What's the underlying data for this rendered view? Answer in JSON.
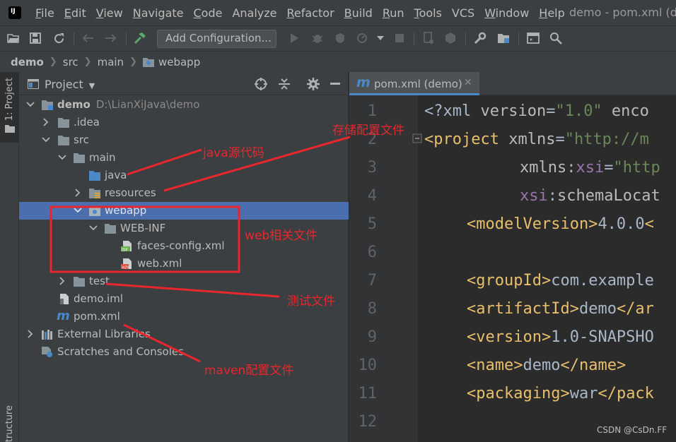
{
  "menubar": {
    "items": [
      {
        "label": "File",
        "ul": "F",
        "rest": "ile"
      },
      {
        "label": "Edit",
        "ul": "E",
        "rest": "dit"
      },
      {
        "label": "View",
        "ul": "V",
        "rest": "iew"
      },
      {
        "label": "Navigate",
        "ul": "N",
        "rest": "avigate"
      },
      {
        "label": "Code",
        "ul": "C",
        "rest": "ode"
      },
      {
        "label": "Analyze",
        "ul": "",
        "rest": "Analyze"
      },
      {
        "label": "Refactor",
        "ul": "R",
        "rest": "efactor"
      },
      {
        "label": "Build",
        "ul": "B",
        "rest": "uild"
      },
      {
        "label": "Run",
        "ul": "R",
        "rest": "un"
      },
      {
        "label": "Tools",
        "ul": "T",
        "rest": "ools"
      },
      {
        "label": "VCS",
        "ul": "",
        "rest": "VCS"
      },
      {
        "label": "Window",
        "ul": "W",
        "rest": "indow"
      },
      {
        "label": "Help",
        "ul": "H",
        "rest": "elp"
      }
    ],
    "window_title": "demo - pom.xml (de"
  },
  "toolbar": {
    "add_config_label": "Add Configuration..."
  },
  "breadcrumb": [
    "demo",
    "src",
    "main",
    "webapp"
  ],
  "stripe": {
    "project_label": "1: Project",
    "structure_label": "Structure"
  },
  "project_panel": {
    "title": "Project",
    "tree": [
      {
        "label": "demo",
        "path": "D:\\LianXiJava\\demo",
        "bold": true
      },
      {
        "label": ".idea"
      },
      {
        "label": "src"
      },
      {
        "label": "main"
      },
      {
        "label": "java"
      },
      {
        "label": "resources"
      },
      {
        "label": "webapp"
      },
      {
        "label": "WEB-INF"
      },
      {
        "label": "faces-config.xml"
      },
      {
        "label": "web.xml"
      },
      {
        "label": "test"
      },
      {
        "label": "demo.iml"
      },
      {
        "label": "pom.xml"
      },
      {
        "label": "External Libraries"
      },
      {
        "label": "Scratches and Consoles"
      }
    ]
  },
  "editor": {
    "tab_label": "pom.xml (demo)",
    "line_numbers": [
      "1",
      "2",
      "3",
      "4",
      "5",
      "6",
      "7",
      "8",
      "9",
      "10",
      "11",
      "12"
    ],
    "code": {
      "l1_a": "<?xml ",
      "l1_b": "version",
      "l1_c": "=",
      "l1_d": "\"1.0\"",
      "l1_e": " enco",
      "l2_a": "<project ",
      "l2_b": "xmlns",
      "l2_c": "=",
      "l2_d": "\"http://m",
      "l3_a": "xmlns",
      "l3_b": ":",
      "l3_c": "xsi",
      "l3_d": "=",
      "l3_e": "\"http",
      "l4_a": "xsi",
      "l4_b": ":",
      "l4_c": "schemaLocat",
      "l5_a": "<modelVersion>",
      "l5_b": "4.0.0",
      "l5_c": "<",
      "l7_a": "<groupId>",
      "l7_b": "com.example",
      "l8_a": "<artifactId>",
      "l8_b": "demo",
      "l8_c": "</ar",
      "l9_a": "<version>",
      "l9_b": "1.0-SNAPSHO",
      "l10_a": "<name>",
      "l10_b": "demo",
      "l10_c": "</name>",
      "l11_a": "<packaging>",
      "l11_b": "war",
      "l11_c": "</pack"
    }
  },
  "annotations": {
    "java": "java源代码",
    "config": "存储配置文件",
    "web": "web相关文件",
    "test": "测试文件",
    "maven": "maven配置文件",
    "color": "#e8262e"
  },
  "watermark": "CSDN @CsDn.FF"
}
